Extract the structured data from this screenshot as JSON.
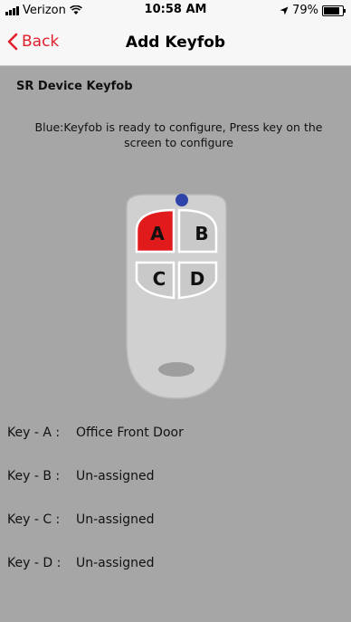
{
  "status": {
    "carrier": "Verizon",
    "time": "10:58 AM",
    "battery_percent": "79%",
    "battery_level": 0.79
  },
  "nav": {
    "back_label": "Back",
    "title": "Add Keyfob"
  },
  "device": {
    "title": "SR Device Keyfob",
    "instructions": "Blue:Keyfob is ready to configure, Press key on the screen to configure"
  },
  "keyfob": {
    "keys": [
      "A",
      "B",
      "C",
      "D"
    ],
    "selected_key": "A",
    "indicator_color": "#2f44a8",
    "selected_color": "#e11b1b"
  },
  "assignments": [
    {
      "label": "Key - A :",
      "value": "Office Front Door"
    },
    {
      "label": "Key - B :",
      "value": "Un-assigned"
    },
    {
      "label": "Key - C :",
      "value": "Un-assigned"
    },
    {
      "label": "Key - D :",
      "value": "Un-assigned"
    }
  ]
}
